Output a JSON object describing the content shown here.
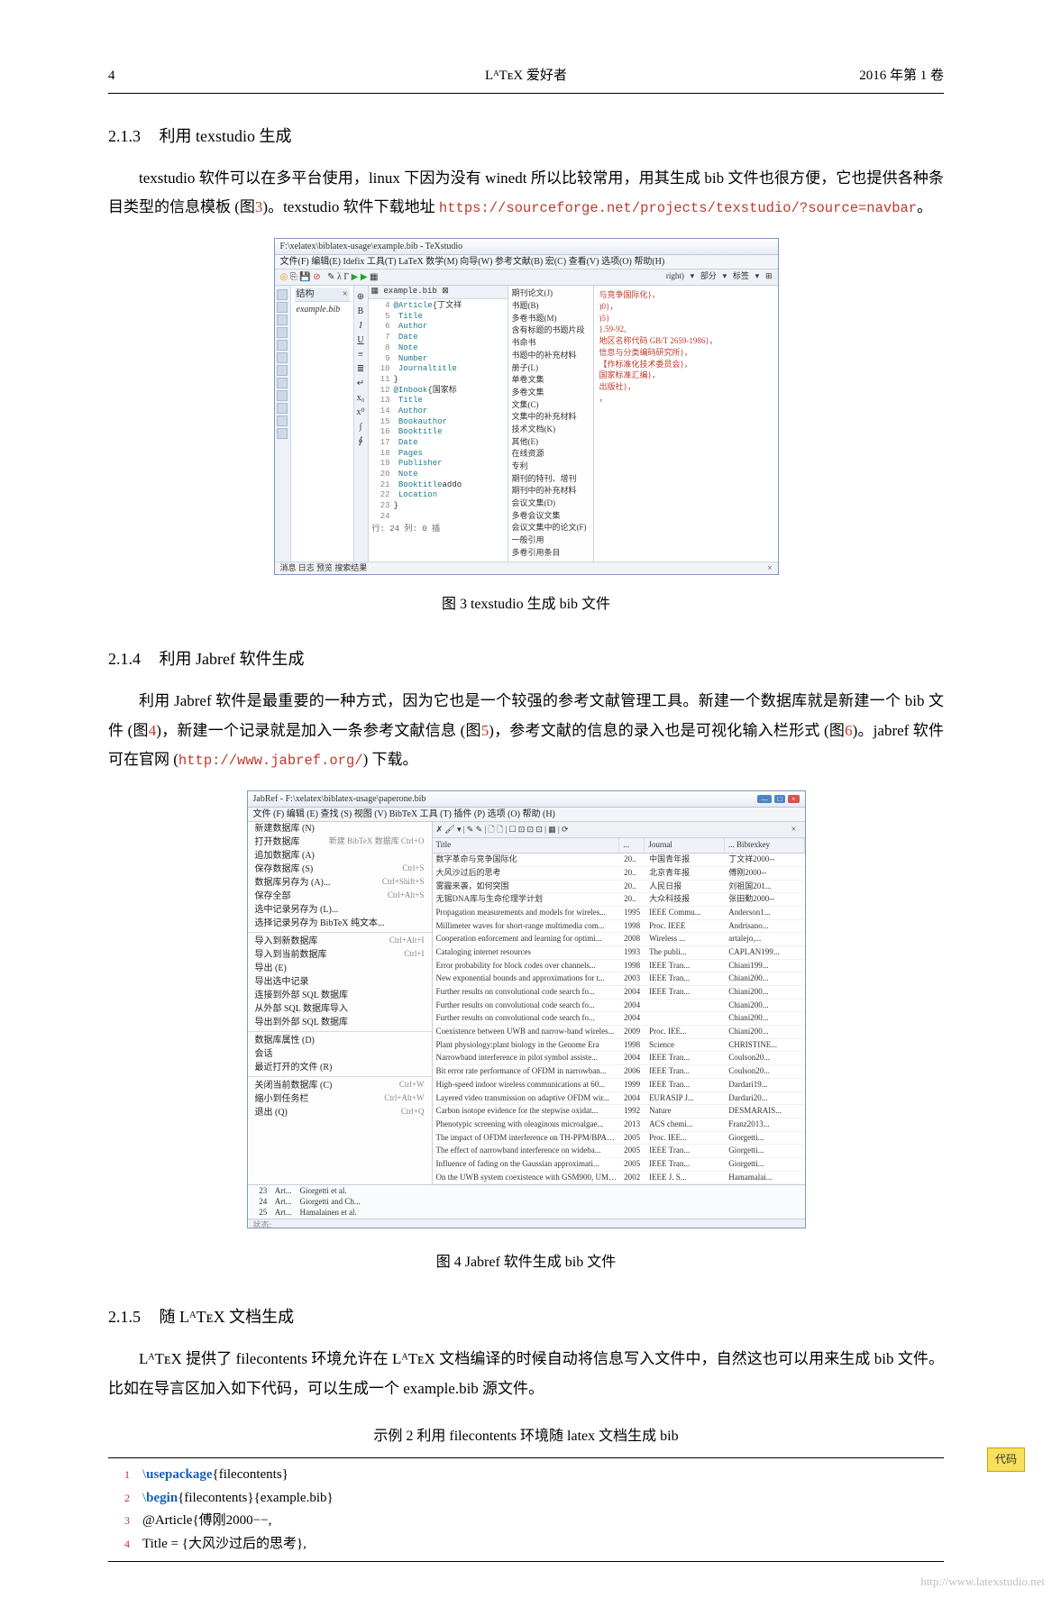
{
  "header": {
    "page": "4",
    "center": "LᴬTᴇX 爱好者",
    "right": "2016 年第 1 卷"
  },
  "s213": {
    "num": "2.1.3",
    "title": "利用 texstudio 生成",
    "para1a": "texstudio 软件可以在多平台使用，linux 下因为没有 winedt 所以比较常用，用其生成 bib 文件也很方便，它也提供各种条目类型的信息模板 (图",
    "figref": "3",
    "para1b": ")。texstudio 软件下载地址 ",
    "url": "https://sourceforge.net/projects/texstudio/?source=navbar",
    "para1c": "。"
  },
  "fig3": {
    "caption": "图 3 texstudio 生成 bib 文件",
    "window_title": "F:\\xelatex\\biblatex-usage\\example.bib - TeXstudio",
    "menubar": "文件(F)  编辑(E)  Idefix  工具(T)  LaTeX  数学(M)  向导(W)  参考文献(B)  宏(C)  查看(V)  选项(O)  帮助(H)",
    "structure_head": "结构",
    "structure_file": "example.bib",
    "tab": "example.bib",
    "code": [
      {
        "n": "4",
        "t": "@Article{丁文祥"
      },
      {
        "n": "5",
        "t": "  Title"
      },
      {
        "n": "6",
        "t": "  Author"
      },
      {
        "n": "7",
        "t": "  Date"
      },
      {
        "n": "8",
        "t": "  Note"
      },
      {
        "n": "9",
        "t": "  Number"
      },
      {
        "n": "10",
        "t": "  Journaltitle"
      },
      {
        "n": "11",
        "t": "}"
      },
      {
        "n": "12",
        "t": "@Inbook{国家标"
      },
      {
        "n": "13",
        "t": "  Title"
      },
      {
        "n": "14",
        "t": "  Author"
      },
      {
        "n": "15",
        "t": "  Bookauthor"
      },
      {
        "n": "16",
        "t": "  Booktitle"
      },
      {
        "n": "17",
        "t": "  Date"
      },
      {
        "n": "18",
        "t": "  Pages"
      },
      {
        "n": "19",
        "t": "  Publisher"
      },
      {
        "n": "20",
        "t": "  Note"
      },
      {
        "n": "21",
        "t": "  Booktitleaddo"
      },
      {
        "n": "22",
        "t": "  Location"
      },
      {
        "n": "23",
        "t": "}"
      },
      {
        "n": "24",
        "t": ""
      }
    ],
    "status": "行: 24    列: 0    插",
    "status_tabs": "消息   日志   预览   搜索结果",
    "popup": [
      "期刊论文(J)",
      "书题(B)",
      "多卷书题(M)",
      "含有标题的书题片段",
      "书命书",
      "书题中的补充材料",
      "册子(L)",
      "单卷文集",
      "多卷文集",
      "文集(C)",
      "文集中的补充材料",
      "技术文档(K)",
      "其他(E)",
      "在线资源",
      "专利",
      "期刊的特刊、增刊",
      "期刊中的补充材料",
      "会议文集(D)",
      "多卷会议文集",
      "会议文集中的论文(F)",
      "一般引用",
      "多卷引用条目"
    ],
    "rightpane": [
      "与竞争国际化}，",
      ")0}，",
      ")5}",
      "}.59-92,",
      "地区名称代码 GB/T 2659-1986}，",
      "信息与分类编码研究所}，",
      "【作标准化技术委员会}，",
      "国家标准汇编}，",
      "出版社}，",
      "，"
    ]
  },
  "s214": {
    "num": "2.1.4",
    "title": "利用 Jabref 软件生成",
    "para1a": "利用 Jabref 软件是最重要的一种方式，因为它也是一个较强的参考文献管理工具。新建一个数据库就是新建一个 bib 文件 (图",
    "ref4": "4",
    "para1b": ")，新建一个记录就是加入一条参考文献信息 (图",
    "ref5": "5",
    "para1c": ")，参考文献的信息的录入也是可视化输入栏形式 (图",
    "ref6": "6",
    "para1d": ")。jabref 软件可在官网 (",
    "url": "http://www.jabref.org/",
    "para1e": ") 下载。"
  },
  "fig4": {
    "caption": "图 4 Jabref 软件生成 bib 文件",
    "window_title": "JabRef - F:\\xelatex\\biblatex-usage\\paperone.bib",
    "menubar": "文件 (F)  编辑 (E)  查找 (S)  视图 (V)  BibTeX  工具 (T)  插件 (P)  选项 (O)  帮助 (H)",
    "filemenu": [
      {
        "label": "新建数据库 (N)",
        "sc": ""
      },
      {
        "label": "打开数据库",
        "sc": "新建 BibTeX 数据库  Ctrl+O"
      },
      {
        "label": "追加数据库 (A)",
        "sc": ""
      },
      {
        "label": "保存数据库 (S)",
        "sc": "Ctrl+S"
      },
      {
        "label": "数据库另存为 (A)...",
        "sc": "Ctrl+Shift+S"
      },
      {
        "label": "保存全部",
        "sc": "Ctrl+Alt+S"
      },
      {
        "label": "选中记录另存为 (L)...",
        "sc": ""
      },
      {
        "label": "选择记录另存为 BibTeX 纯文本...",
        "sc": ""
      },
      {
        "label": "",
        "sc": ""
      },
      {
        "label": "导入到新数据库",
        "sc": "Ctrl+Alt+I"
      },
      {
        "label": "导入到当前数据库",
        "sc": "Ctrl+I"
      },
      {
        "label": "导出 (E)",
        "sc": ""
      },
      {
        "label": "导出选中记录",
        "sc": ""
      },
      {
        "label": "连接到外部 SQL 数据库",
        "sc": ""
      },
      {
        "label": "从外部 SQL 数据库导入",
        "sc": ""
      },
      {
        "label": "导出到外部 SQL 数据库",
        "sc": ""
      },
      {
        "label": "",
        "sc": ""
      },
      {
        "label": "数据库属性 (D)",
        "sc": ""
      },
      {
        "label": "会话",
        "sc": ""
      },
      {
        "label": "最近打开的文件 (R)",
        "sc": ""
      },
      {
        "label": "",
        "sc": ""
      },
      {
        "label": "关闭当前数据库 (C)",
        "sc": "Ctrl+W"
      },
      {
        "label": "缩小到任务栏",
        "sc": "Ctrl+Alt+W"
      },
      {
        "label": "退出 (Q)",
        "sc": "Ctrl+Q"
      }
    ],
    "table_head": {
      "title": "Title",
      "year": "...",
      "journal": "Journal",
      "key": "... Bibtexkey"
    },
    "rows": [
      {
        "t": "数字革命与竞争国际化",
        "y": "20..",
        "j": "中国青年报",
        "k": "丁文祥2000--"
      },
      {
        "t": "大风沙过后的思考",
        "y": "20..",
        "j": "北京青年报",
        "k": "傅刚2000--"
      },
      {
        "t": "雾霾来袭，如何突围",
        "y": "20..",
        "j": "人民日报",
        "k": "刘祖国201..."
      },
      {
        "t": "无锡DNA库与生命伦理学计划",
        "y": "20..",
        "j": "大众科技报",
        "k": "张田勤2000--"
      },
      {
        "t": "Propagation measurements and models for wireles...",
        "y": "1995",
        "j": "IEEE Commu...",
        "k": "Anderson1..."
      },
      {
        "t": "Millimeter waves for short-range multimedia com...",
        "y": "1998",
        "j": "Proc. IEEE",
        "k": "Andrisano..."
      },
      {
        "t": "Cooperation enforcement and learning for optimi...",
        "y": "2008",
        "j": "Wireless ...",
        "k": "artalejo,..."
      },
      {
        "t": "Cataloging internet resources",
        "y": "1993",
        "j": "The publi...",
        "k": "CAPLAN199..."
      },
      {
        "t": "Error probability for block codes over channels...",
        "y": "1998",
        "j": "IEEE Tran...",
        "k": "Chiani199..."
      },
      {
        "t": "New exponential bounds and approximations for t...",
        "y": "2003",
        "j": "IEEE Tran...",
        "k": "Chiani200..."
      },
      {
        "t": "Further results on convolutional code search fo...",
        "y": "2004",
        "j": "IEEE Tran...",
        "k": "Chiani200..."
      },
      {
        "t": "Further results on convolutional code search fo...",
        "y": "2004",
        "j": "",
        "k": "Chiani200..."
      },
      {
        "t": "Further results on convolutional code search fo...",
        "y": "2004",
        "j": "",
        "k": "Chiani200..."
      },
      {
        "t": "Coexistence between UWB and narrow-band wireles...",
        "y": "2009",
        "j": "Proc. IEE...",
        "k": "Chiani200..."
      },
      {
        "t": "Plant physiology:plant biology in the Genome Era",
        "y": "1998",
        "j": "Science",
        "k": "CHRISTINE..."
      },
      {
        "t": "Narrowband interference in pilot symbol assiste...",
        "y": "2004",
        "j": "IEEE Tran...",
        "k": "Coulson20..."
      },
      {
        "t": "Bit error rate performance of OFDM in narrowban...",
        "y": "2006",
        "j": "IEEE Tran...",
        "k": "Coulson20..."
      },
      {
        "t": "High-speed indoor wireless communications at 60...",
        "y": "1999",
        "j": "IEEE Tran...",
        "k": "Dardari19..."
      },
      {
        "t": "Layered video transmission on adaptive OFDM wir...",
        "y": "2004",
        "j": "EURASIP J...",
        "k": "Dardari20..."
      },
      {
        "t": "Carbon isotope evidence for the stepwise oxidat...",
        "y": "1992",
        "j": "Nature",
        "k": "DESMARAIS..."
      },
      {
        "t": "Phenotypic screening with oleaginous microalgae...",
        "y": "2013",
        "j": "ACS chemi...",
        "k": "Franz2013..."
      },
      {
        "t": "The impact of OFDM interference on TH-PPM/BPAM ...",
        "y": "2005",
        "j": "Proc. IEE...",
        "k": "Giorgetti..."
      },
      {
        "t": "The effect of narrowband interference on wideba...",
        "y": "2005",
        "j": "IEEE Tran...",
        "k": "Giorgetti..."
      },
      {
        "t": "Influence of fading on the Gaussian approximati...",
        "y": "2005",
        "j": "IEEE Tran...",
        "k": "Giorgetti..."
      },
      {
        "t": "On the UWB system coexistence with GSM900, UMTS...",
        "y": "2002",
        "j": "IEEE J. S...",
        "k": "Hamamalai..."
      }
    ],
    "bottom_rows": [
      {
        "n": "23",
        "a": "Art...",
        "au": "Giorgetti et al."
      },
      {
        "n": "24",
        "a": "Art...",
        "au": "Giorgetti and Ch..."
      },
      {
        "n": "25",
        "a": "Art...",
        "au": "Hamalainen et al."
      }
    ]
  },
  "s215": {
    "num": "2.1.5",
    "title": "随 LᴬTᴇX 文档生成",
    "para1": "LᴬTᴇX 提供了 filecontents 环境允许在 LᴬTᴇX 文档编译的时候自动将信息写入文件中，自然这也可以用来生成 bib 文件。比如在导言区加入如下代码，可以生成一个 example.bib 源文件。"
  },
  "listing": {
    "title": "示例 2 利用 filecontents 环境随 latex 文档生成 bib",
    "badge": "代码",
    "lines": [
      {
        "n": "1",
        "cmd": "\\usepackage",
        "arg": "{filecontents}"
      },
      {
        "n": "2",
        "cmd": "\\begin",
        "arg": "{filecontents}{example.bib}"
      },
      {
        "n": "3",
        "plain": "@Article{傅刚2000−−,"
      },
      {
        "n": "4",
        "plain": "    Title = {大风沙过后的思考},"
      }
    ]
  },
  "watermark": "http://www.latexstudio.net"
}
